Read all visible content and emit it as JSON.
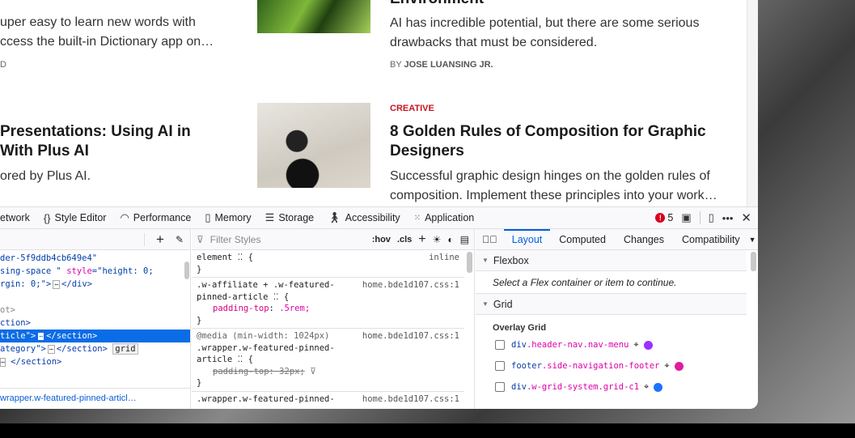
{
  "articles": [
    {
      "excerpt_1": "uper easy to learn new words with",
      "excerpt_2": "ccess the built-in Dictionary app on…",
      "byline": "D"
    },
    {
      "title": "Environment",
      "excerpt_1": "AI has incredible potential, but there are some serious",
      "excerpt_2": "drawbacks that must be considered.",
      "by": "BY",
      "author": "JOSE LUANSING JR."
    },
    {
      "title_1": "Presentations: Using AI in",
      "title_2": "With Plus AI",
      "excerpt": "ored by Plus AI."
    },
    {
      "category": "CREATIVE",
      "title_1": "8 Golden Rules of Composition for Graphic",
      "title_2": "Designers",
      "excerpt_1": "Successful graphic design hinges on the golden rules of",
      "excerpt_2": "composition. Implement these principles into your work…"
    }
  ],
  "colors": {
    "category": "#c4161c",
    "accent": "#0060df",
    "purple": "#9933ff",
    "magenta": "#e01b9e",
    "blue": "#1a73ff"
  },
  "toolbar": {
    "tools": [
      "etwork",
      "Style Editor",
      "Performance",
      "Memory",
      "Storage",
      "Accessibility",
      "Application"
    ],
    "error_count": "5"
  },
  "inspector": {
    "lines": [
      {
        "a": "der-5f9ddb4cb649e4\""
      },
      {
        "a": "sing-space \" ",
        "b": "style",
        "c": "=\"height: 0;"
      },
      {
        "a": "rgin: 0;\">",
        "d": "</div>"
      },
      {
        "a": ""
      },
      {
        "a": "ot>"
      },
      {
        "a": "ction>"
      },
      {
        "a": "ticle\">",
        "d": "</section>"
      },
      {
        "a": "ategory\">",
        "d": "</section>",
        "badge": "grid"
      },
      {
        "a": "",
        "d": "</section>"
      }
    ],
    "breadcrumb": "wrapper.w-featured-pinned-articl…"
  },
  "rules": {
    "filter_placeholder": "Filter Styles",
    "hov": ":hov",
    "cls": ".cls",
    "r1": {
      "sel": "element",
      "brace": "{",
      "close": "}",
      "src": "inline"
    },
    "r2": {
      "sel1": ".w-affiliate + .w-featured-",
      "sel2": "pinned-article",
      "prop": "padding-top",
      ":": ":",
      "val": ".5rem",
      "src": "home.bde1d107.css:1"
    },
    "r3": {
      "media": "@media (min-width: 1024px)",
      "sel1": ".wrapper.w-featured-pinned-",
      "sel2": "article",
      "prop": "padding-top: 32px;",
      "src": "home.bde1d107.css:1"
    },
    "r4": {
      "sel1": ".wrapper.w-featured-pinned-",
      "src": "home.bde1d107.css:1"
    }
  },
  "layout": {
    "tabs": [
      "Layout",
      "Computed",
      "Changes",
      "Compatibility"
    ],
    "flexbox": "Flexbox",
    "flex_msg": "Select a Flex container or item to continue.",
    "grid": "Grid",
    "overlay": "Overlay Grid",
    "grids": [
      {
        "tag": "div",
        "cls": ".header-nav.nav-menu",
        "color": "#9933ff"
      },
      {
        "tag": "footer",
        "cls": ".side-navigation-footer",
        "color": "#e01b9e"
      },
      {
        "tag": "div",
        "cls": ".w-grid-system.grid-c1",
        "color": "#1a73ff"
      }
    ]
  }
}
